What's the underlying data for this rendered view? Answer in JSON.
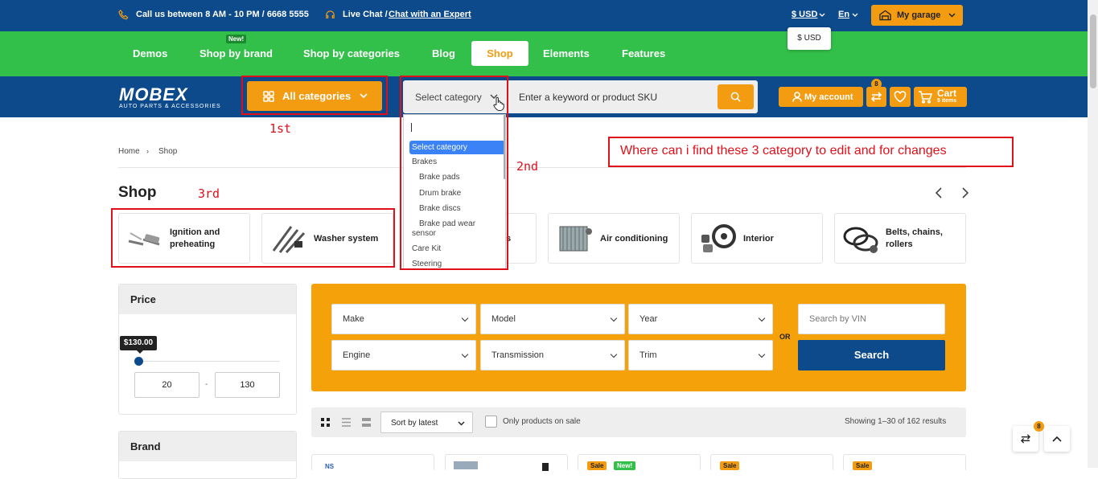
{
  "topbar": {
    "call_text": "Call us between 8 AM - 10 PM / ",
    "phone": "6668 5555",
    "chat_text": "Live Chat / ",
    "chat_link": "Chat with an Expert",
    "currency": "$ USD",
    "language": "En",
    "garage": "My garage",
    "currency_option": "$ USD"
  },
  "nav": {
    "items": [
      "Demos",
      "Shop by brand",
      "Shop by categories",
      "Blog",
      "Shop",
      "Elements",
      "Features"
    ],
    "new_badge": "New!"
  },
  "header": {
    "logo": "MOBEX",
    "logo_sub": "AUTO PARTS & ACCESSORIES",
    "all_categories": "All categories",
    "select_category": "Select category",
    "search_placeholder": "Enter a keyword or product SKU",
    "account": "My account",
    "compare_count": "8",
    "cart_label": "Cart",
    "cart_items": "5 items"
  },
  "dropdown": {
    "options": [
      "Select category",
      "Brakes",
      "Brake pads",
      "Drum brake",
      "Brake discs",
      "Brake pad wear",
      "sensor",
      "Care Kit",
      "Steering"
    ]
  },
  "annotations": {
    "first": "1st",
    "second": "2nd",
    "third": "3rd",
    "question": "Where can i find these 3 category to edit and for changes"
  },
  "breadcrumb": [
    "Home",
    "Shop"
  ],
  "page_title": "Shop",
  "categories": [
    "Ignition and preheating",
    "Washer system",
    "s",
    "Air conditioning",
    "Interior",
    "Belts, chains, rollers"
  ],
  "sidebar": {
    "price_title": "Price",
    "price_tooltip": "$130.00",
    "price_min": "20",
    "price_sep": "-",
    "price_max": "130",
    "brand_title": "Brand"
  },
  "finder": {
    "fields": [
      "Make",
      "Model",
      "Year",
      "Engine",
      "Transmission",
      "Trim"
    ],
    "or": "OR",
    "vin_placeholder": "Search by VIN",
    "search_button": "Search"
  },
  "toolbar": {
    "sort": "Sort by latest",
    "only_sale": "Only products on sale",
    "showing": "Showing 1–30 of 162 results"
  },
  "products": {
    "sale": "Sale",
    "new": "New!",
    "ns": "NS"
  },
  "floating": {
    "compare_count": "8"
  }
}
